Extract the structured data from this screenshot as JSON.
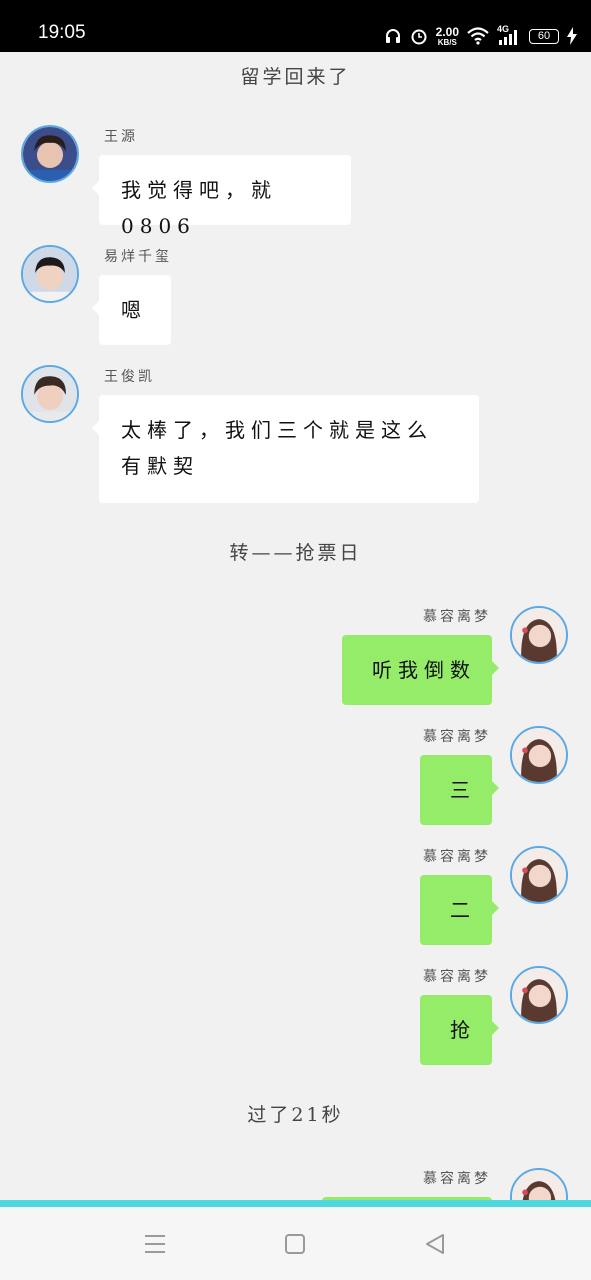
{
  "status_bar": {
    "time": "19:05",
    "network_speed_value": "2.00",
    "network_speed_unit": "KB/S",
    "network_type": "4G",
    "battery_level": "60",
    "icons": [
      "headphones-icon",
      "alarm-icon",
      "wifi-icon",
      "signal-icon",
      "battery-icon",
      "charging-icon"
    ]
  },
  "chat": {
    "narration_1": "留学回来了",
    "narration_2": "转——抢票日",
    "narration_3": "过了21秒",
    "messages": [
      {
        "sender": "王源",
        "text": "我觉得吧，就0806",
        "side": "left"
      },
      {
        "sender": "易烊千玺",
        "text": "嗯",
        "side": "left"
      },
      {
        "sender": "王俊凯",
        "text_line1": "太棒了，我们三个就是这么",
        "text_line2": "有默契",
        "side": "left"
      },
      {
        "sender": "慕容离梦",
        "text": "听我倒数",
        "side": "right"
      },
      {
        "sender": "慕容离梦",
        "text": "三",
        "side": "right"
      },
      {
        "sender": "慕容离梦",
        "text": "二",
        "side": "right"
      },
      {
        "sender": "慕容离梦",
        "text": "抢",
        "side": "right"
      },
      {
        "sender": "慕容离梦",
        "side": "right"
      }
    ]
  },
  "colors": {
    "right_bubble": "#95ec69",
    "left_bubble": "#ffffff",
    "background": "#f1f1f1",
    "avatar_border": "#5aa9e6",
    "accent_line": "#4fd8dc"
  },
  "nav_bar": {
    "icons": [
      "menu-icon",
      "home-square-icon",
      "back-triangle-icon"
    ]
  }
}
